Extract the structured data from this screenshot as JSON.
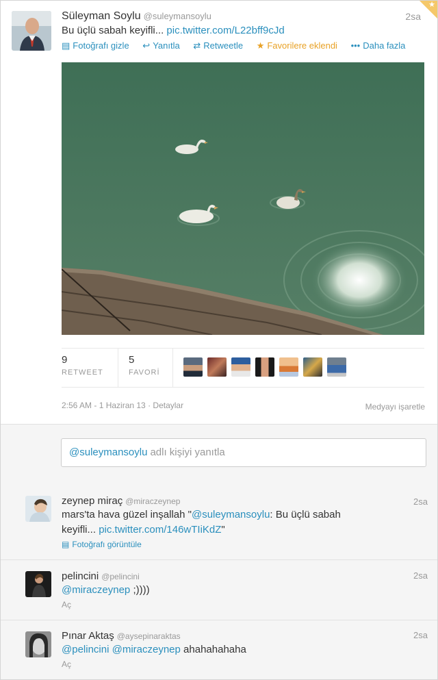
{
  "tweet": {
    "name": "Süleyman Soylu",
    "handle": "@suleymansoylu",
    "time": "2sa",
    "text": "Bu üçlü sabah keyifli...",
    "link": "pic.twitter.com/L22bff9cJd",
    "actions": {
      "hide_photo": "Fotoğrafı gizle",
      "reply": "Yanıtla",
      "retweet": "Retweetle",
      "favorited": "Favorilere eklendi",
      "more": "Daha fazla"
    },
    "retweet_count": "9",
    "retweet_label": "RETWEET",
    "favorite_count": "5",
    "favorite_label": "FAVORİ",
    "timestamp": "2:56 AM - 1 Haziran 13",
    "details": "Detaylar",
    "flag_media": "Medyayı işaretle"
  },
  "reply_box": {
    "mention": "@suleymansoylu",
    "placeholder": "adlı kişiyi yanıtla"
  },
  "replies": [
    {
      "name": "zeynep miraç",
      "handle": "@miraczeynep",
      "time": "2sa",
      "text_prefix": "mars'ta hava güzel inşallah \"",
      "mention": "@suleymansoylu",
      "text_mid": ": Bu üçlü sabah",
      "text_line2": "keyifli... ",
      "link": "pic.twitter.com/146wTIiKdZ",
      "text_suffix": "\"",
      "view_photo": "Fotoğrafı görüntüle"
    },
    {
      "name": "pelincini",
      "handle": "@pelincini",
      "time": "2sa",
      "mention": "@miraczeynep",
      "text": ";))))",
      "open": "Aç"
    },
    {
      "name": "Pınar Aktaş",
      "handle": "@aysepinaraktas",
      "time": "2sa",
      "mention1": "@pelincini",
      "mention2": "@miraczeynep",
      "text": "ahahahahaha",
      "open": "Aç"
    }
  ],
  "colors": {
    "link": "#2a8fbd",
    "favorite": "#e8a125",
    "water": "#4f7d63"
  }
}
